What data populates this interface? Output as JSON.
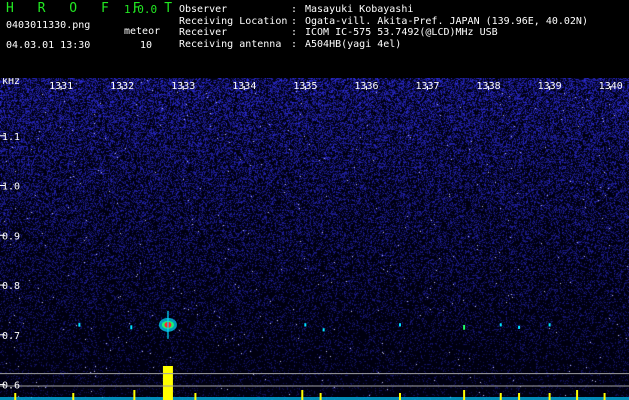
{
  "header": {
    "app_title": "H R O F F T",
    "app_version": "1.0.0",
    "file_name": "0403011330.png",
    "datetime": "04.03.01 13:30",
    "meteor_label": "meteor",
    "meteor_count": "10",
    "info": [
      {
        "key": "Observer",
        "value": "Masayuki Kobayashi"
      },
      {
        "key": "Receiving Location",
        "value": "Ogata-vill. Akita-Pref. JAPAN (139.96E, 40.02N)"
      },
      {
        "key": "Receiver",
        "value": "ICOM IC-575 53.7492(@LCD)MHz USB"
      },
      {
        "key": "Receiving antenna",
        "value": "A504HB(yagi 4el)"
      }
    ]
  },
  "chart_data": {
    "type": "heatmap",
    "ylabel": "kHz",
    "x_ticks": [
      "1331",
      "1332",
      "1333",
      "1334",
      "1335",
      "1336",
      "1337",
      "1338",
      "1339",
      "1340"
    ],
    "y_ticks": [
      "1.1",
      "1.0",
      "0.9",
      "0.8",
      "0.7",
      "0.6"
    ],
    "y_tick_values": [
      1.1,
      1.0,
      0.9,
      0.8,
      0.7,
      0.6
    ],
    "ylim": [
      0.575,
      1.2
    ],
    "xlim": [
      1330,
      1340.3
    ],
    "meteor_echoes": [
      {
        "time_min": 1332.75,
        "freq_khz": 0.72,
        "strength": 1.0
      },
      {
        "time_min": 1332.15,
        "freq_khz": 0.715,
        "strength": 0.25
      },
      {
        "time_min": 1331.3,
        "freq_khz": 0.72,
        "strength": 0.2
      },
      {
        "time_min": 1335.0,
        "freq_khz": 0.72,
        "strength": 0.15
      },
      {
        "time_min": 1335.3,
        "freq_khz": 0.71,
        "strength": 0.15
      },
      {
        "time_min": 1336.55,
        "freq_khz": 0.72,
        "strength": 0.15
      },
      {
        "time_min": 1337.6,
        "freq_khz": 0.715,
        "strength": 0.35
      },
      {
        "time_min": 1338.2,
        "freq_khz": 0.72,
        "strength": 0.15
      },
      {
        "time_min": 1338.5,
        "freq_khz": 0.715,
        "strength": 0.15
      },
      {
        "time_min": 1339.0,
        "freq_khz": 0.72,
        "strength": 0.15
      }
    ],
    "activity_bars": [
      {
        "time_min": 1330.25,
        "level": 0.1
      },
      {
        "time_min": 1331.2,
        "level": 0.1
      },
      {
        "time_min": 1332.2,
        "level": 0.2
      },
      {
        "time_min": 1332.75,
        "level": 1.0
      },
      {
        "time_min": 1333.2,
        "level": 0.1
      },
      {
        "time_min": 1334.95,
        "level": 0.2
      },
      {
        "time_min": 1335.25,
        "level": 0.1
      },
      {
        "time_min": 1336.55,
        "level": 0.1
      },
      {
        "time_min": 1337.6,
        "level": 0.2
      },
      {
        "time_min": 1338.2,
        "level": 0.1
      },
      {
        "time_min": 1338.5,
        "level": 0.1
      },
      {
        "time_min": 1339.0,
        "level": 0.1
      },
      {
        "time_min": 1339.45,
        "level": 0.2
      },
      {
        "time_min": 1339.9,
        "level": 0.1
      }
    ],
    "colors": {
      "background": "#000010",
      "noise": "#2a2ad6",
      "echo_core": "#ff2a2a",
      "echo_mid": "#22ff66",
      "echo_halo": "#00e0ff",
      "activity": "#ffff00",
      "baseline": "#00c8ff",
      "grid": "#a0a0a0",
      "text": "#ffffff"
    }
  }
}
